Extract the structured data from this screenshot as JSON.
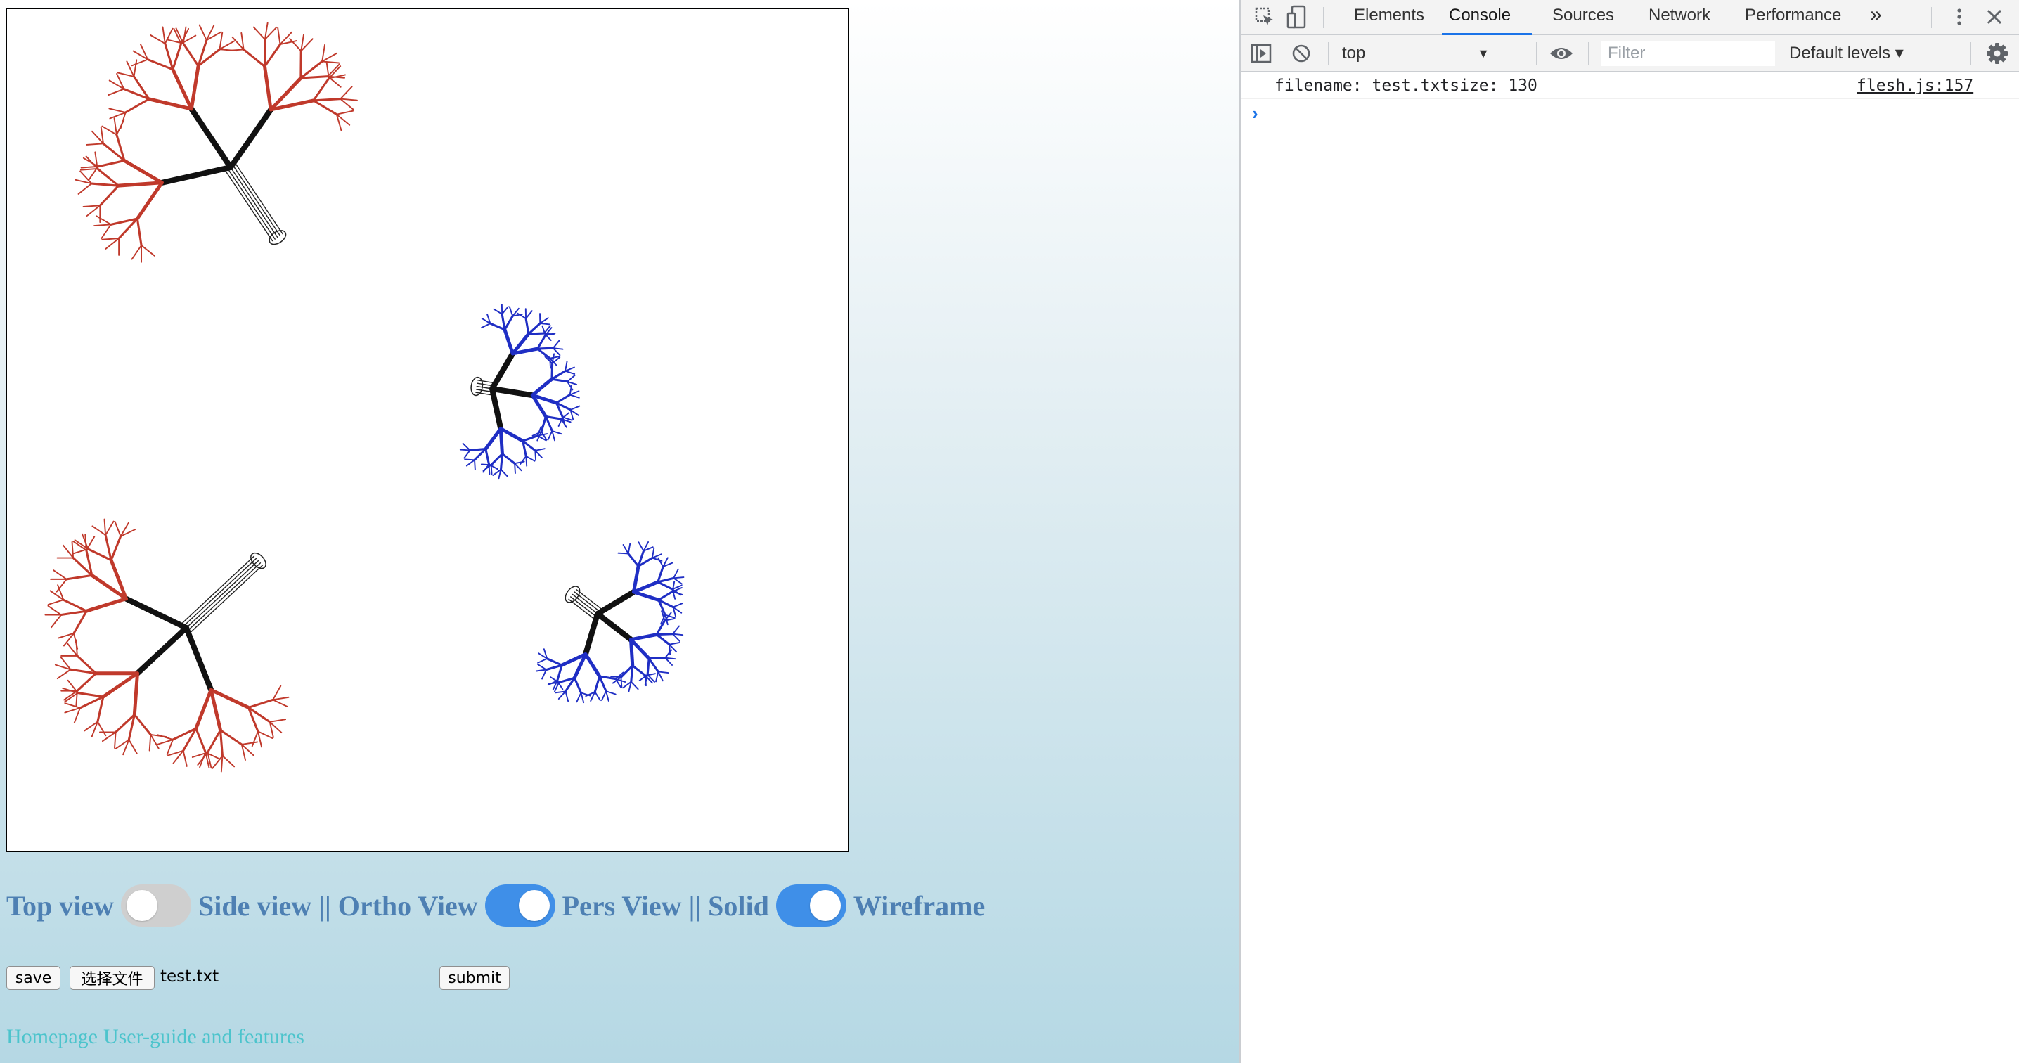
{
  "page": {
    "toggles": [
      {
        "left_label": "Top view",
        "state": "off"
      },
      {
        "left_label": "Side view || Ortho View",
        "state": "on"
      },
      {
        "left_label": "Pers View || Solid",
        "state": "on"
      },
      {
        "trailing_label": "Wireframe"
      }
    ],
    "toggle_labels": {
      "top": "Top view",
      "side_ortho": "Side view || Ortho View",
      "pers_solid": "Pers View || Solid",
      "wireframe": "Wireframe"
    },
    "buttons": {
      "save": "save",
      "choose_file": "选择文件",
      "submit": "submit"
    },
    "file_name": "test.txt",
    "links": {
      "homepage": "Homepage",
      "user_guide": "User-guide and features"
    },
    "colors": {
      "tree_red": "#c0392b",
      "tree_blue": "#1f2ec4",
      "label_blue": "#4e80b3",
      "toggle_on": "#3f8fe8",
      "link": "#4cc4cc"
    }
  },
  "devtools": {
    "tabs": [
      "Elements",
      "Console",
      "Sources",
      "Network",
      "Performance"
    ],
    "active_tab": "Console",
    "more_tabs_icon": "»",
    "context": "top",
    "filter_placeholder": "Filter",
    "levels": "Default levels ▾",
    "log": {
      "message": "filename: test.txtsize: 130",
      "source": "flesh.js:157"
    },
    "prompt": "›"
  }
}
